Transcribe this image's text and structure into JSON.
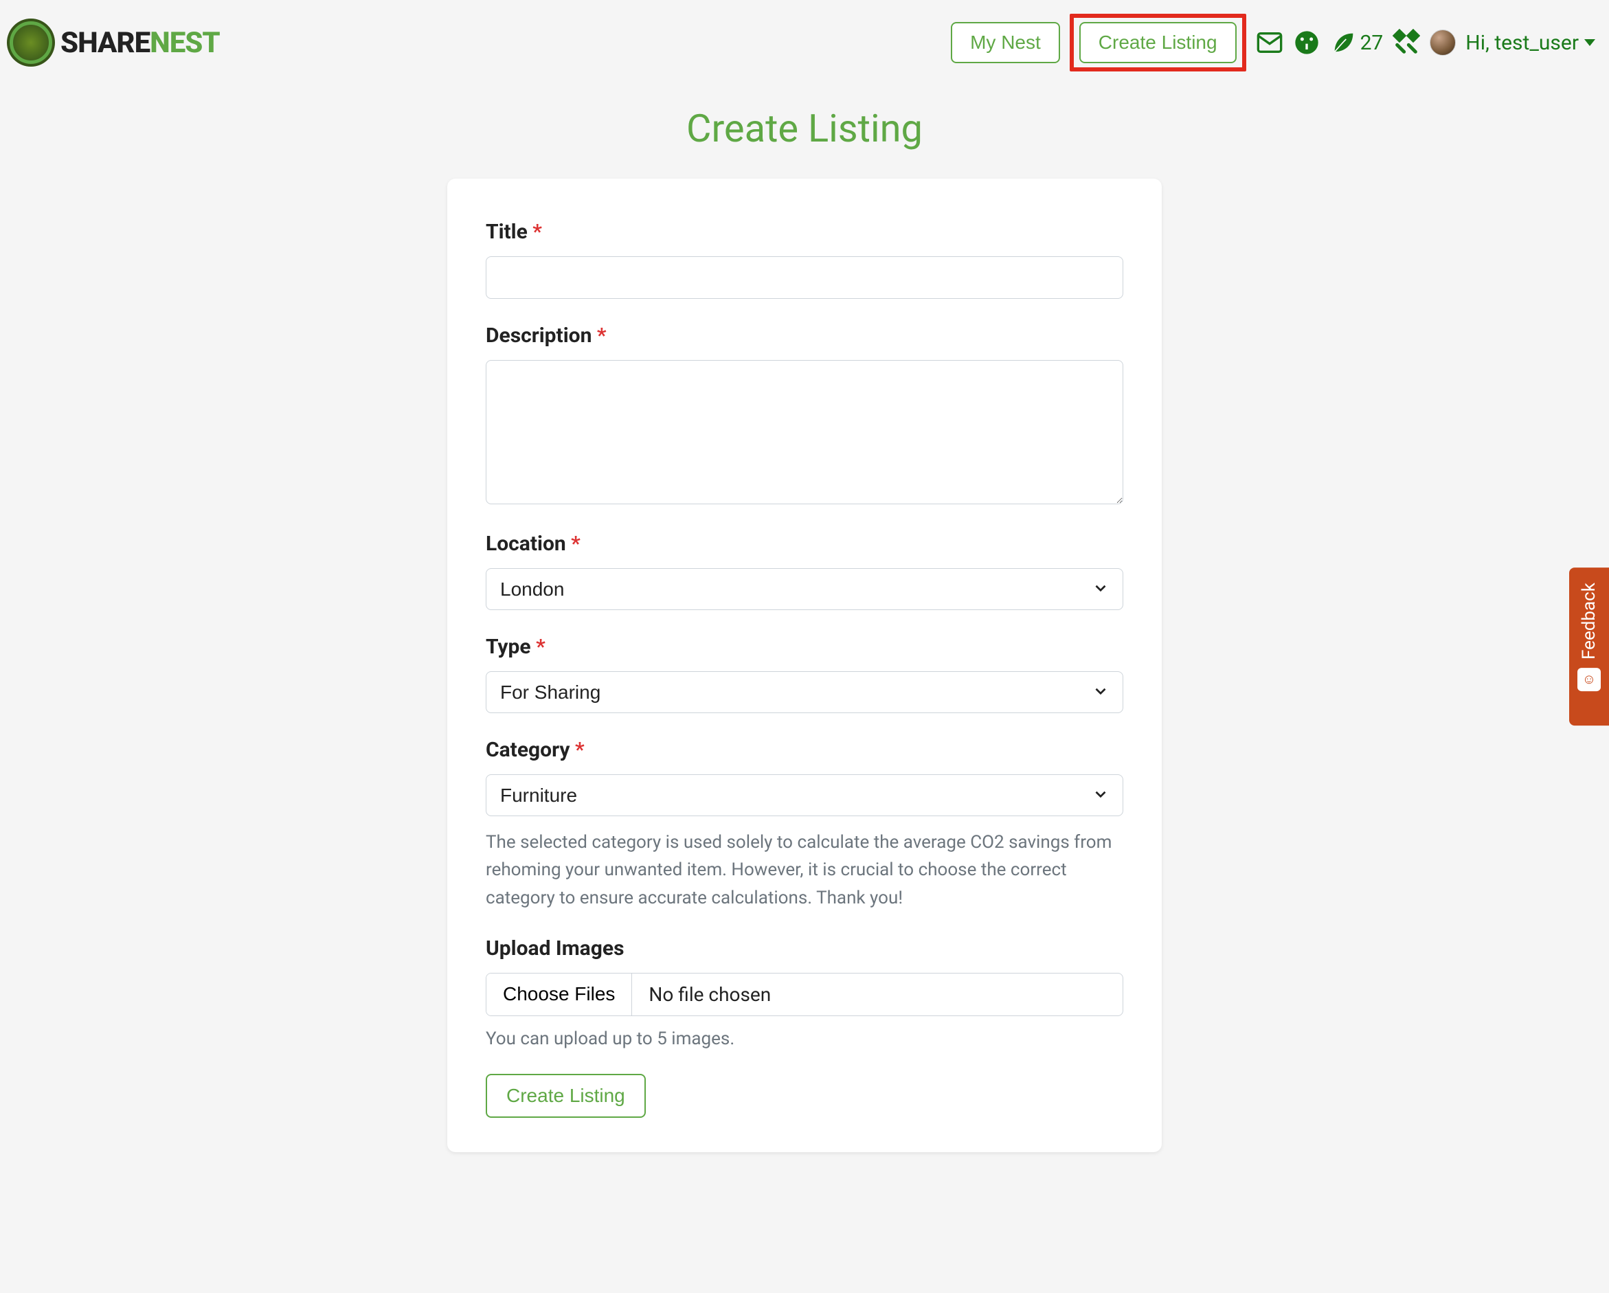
{
  "brand": {
    "name_black": "SHARE",
    "name_green": "NEST"
  },
  "nav": {
    "my_nest": "My Nest",
    "create_listing": "Create Listing",
    "leaf_count": "27",
    "user_greeting": "Hi, test_user"
  },
  "page": {
    "title": "Create Listing"
  },
  "form": {
    "title": {
      "label": "Title",
      "value": ""
    },
    "description": {
      "label": "Description",
      "value": ""
    },
    "location": {
      "label": "Location",
      "selected": "London"
    },
    "type": {
      "label": "Type",
      "selected": "For Sharing"
    },
    "category": {
      "label": "Category",
      "selected": "Furniture",
      "help": "The selected category is used solely to calculate the average CO2 savings from rehoming your unwanted item. However, it is crucial to choose the correct category to ensure accurate calculations. Thank you!"
    },
    "upload": {
      "label": "Upload Images",
      "button": "Choose Files",
      "status": "No file chosen",
      "help": "You can upload up to 5 images."
    },
    "submit": "Create Listing"
  },
  "required_mark": "*",
  "feedback": {
    "label": "Feedback"
  }
}
